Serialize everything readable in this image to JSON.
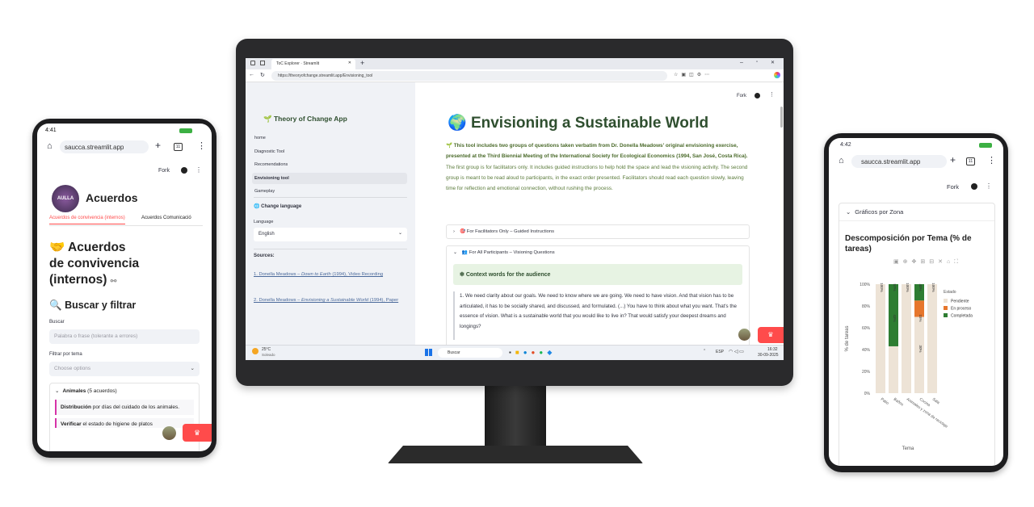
{
  "left_phone": {
    "status_time": "4:41",
    "url": "saucca.streamlit.app",
    "tab_count": "11",
    "fork_label": "Fork",
    "logo_text": "AULLA",
    "title": "Acuerdos",
    "tabs": [
      "Acuerdos de convivencia (internos)",
      "Acuerdos Comunicació"
    ],
    "heading_emoji": "🤝",
    "heading_lines": [
      "Acuerdos",
      "de convivencia",
      "(internos)"
    ],
    "search_heading": "Buscar y filtrar",
    "search_emoji": "🔍",
    "search_label": "Buscar",
    "search_placeholder": "Palabra o frase (tolerante a errores)",
    "filter_label": "Filtrar por tema",
    "filter_placeholder": "Choose options",
    "expander_title": "Animales",
    "expander_count": "(5 acuerdos)",
    "items": [
      {
        "bold": "Distribución",
        "rest": " por días del cuidado de los animales."
      },
      {
        "bold": "Verificar",
        "rest": " el estado de higiene de platos"
      }
    ]
  },
  "desktop": {
    "tab_title": "ToC Explorer · Streamlit",
    "url": "https://theoryofchange.streamlit.app/Envisioning_tool",
    "sidebar": {
      "app_title": "Theory of Change App",
      "app_emoji": "🌱",
      "nav": [
        "home",
        "Diagnostic Tool",
        "Recomendations",
        "Envisioning tool",
        "Gameplay"
      ],
      "active_index": 3,
      "change_language": "Change language",
      "language_label": "Language",
      "language_value": "English",
      "sources_title": "Sources:",
      "sources": [
        {
          "pre": "1. Donella Meadows – ",
          "ital": "Down to Earth",
          "post": " (1994), Video Recording"
        },
        {
          "pre": "2. Donella Meadows – ",
          "ital": "Envisioning a Sustainable World",
          "post": " (1994), Paper"
        }
      ]
    },
    "main": {
      "fork": "Fork",
      "title_emoji": "🌍",
      "title": "Envisioning a Sustainable World",
      "intro_bold": "This tool includes two groups of questions taken verbatim from Dr. Donella Meadows' original envisioning exercise, presented at the Third Biennial Meeting of the International Society for Ecological Economics (1994, San José, Costa Rica).",
      "intro_text": "The first group is for facilitators only. It includes guided instructions to help hold the space and lead the visioning activity. The second group is meant to be read aloud to participants, in the exact order presented. Facilitators should read each question slowly, leaving time for reflection and emotional connection, without rushing the process.",
      "expander1": "For Facilitators Only – Guided Instructions",
      "expander2": "For All Participants – Visioning Questions",
      "context_title": "Context words for the audience",
      "quote": "1. We need clarity about our goals. We need to know where we are going. We need to have vision. And that vision has to be articulated, it has to be socially shared, and discussed, and formulated. (...) You have to think about what you want. That's the essence of vision. What is a sustainable world that you would like to live in? That would satisfy your deepest dreams and longings?"
    },
    "taskbar": {
      "weather_temp": "25°C",
      "weather_desc": "Soleado",
      "search": "Buscar",
      "lang": "ESP",
      "time": "16:32",
      "date": "30-09-2025"
    }
  },
  "right_phone": {
    "status_time": "4:42",
    "url": "saucca.streamlit.app",
    "tab_count": "11",
    "fork": "Fork",
    "expander": "Gráficos por Zona",
    "chart_title": "Descomposición por Tema (% de tareas)"
  },
  "chart_data": {
    "type": "bar",
    "title": "Descomposición por Tema (% de tareas)",
    "xlabel": "Tema",
    "ylabel": "% de tareas",
    "ylim": [
      0,
      100
    ],
    "yticks": [
      "0%",
      "20%",
      "40%",
      "60%",
      "80%",
      "100%"
    ],
    "categories": [
      "Patio",
      "Baños",
      "Animales y zona de reciclaje",
      "Cocina",
      "Sala"
    ],
    "legend_title": "Estado",
    "series": [
      {
        "name": "Pendiente",
        "color": "#ede3d6",
        "values": [
          100,
          43,
          100,
          70,
          100
        ]
      },
      {
        "name": "En proceso",
        "color": "#e6762c",
        "values": [
          0,
          0,
          0,
          15,
          0
        ]
      },
      {
        "name": "Completada",
        "color": "#2e7d32",
        "values": [
          0,
          57,
          0,
          15,
          0
        ]
      }
    ],
    "bar_labels": [
      [
        "100%"
      ],
      [
        "57%",
        "43%"
      ],
      [
        "100%"
      ],
      [
        "40%",
        "15%",
        "30%"
      ],
      [
        "100%"
      ]
    ]
  },
  "colors": {
    "streamlit_red": "#ff4b4b",
    "title_green": "#2f4f2f",
    "text_green": "#5a7a3a"
  }
}
